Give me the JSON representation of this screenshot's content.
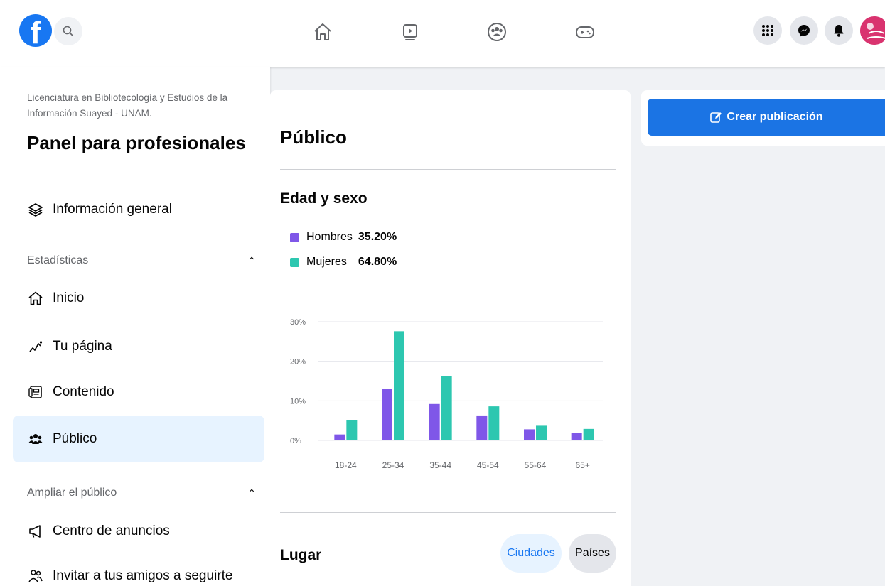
{
  "topbar": {
    "logo_letter": "f",
    "nav_icons": [
      "home-icon",
      "video-icon",
      "groups-icon",
      "gaming-icon"
    ],
    "right_icons": [
      "menu-grid-icon",
      "messenger-icon",
      "bell-icon"
    ]
  },
  "sidebar": {
    "page_name": "Licenciatura en Bibliotecología y Estudios de la Información Suayed - UNAM.",
    "title": "Panel para profesionales",
    "overview": "Información general",
    "stats_section": "Estadísticas",
    "items": [
      {
        "label": "Inicio",
        "icon": "home-outline-icon"
      },
      {
        "label": "Tu página",
        "icon": "trend-icon"
      },
      {
        "label": "Contenido",
        "icon": "content-icon"
      },
      {
        "label": "Público",
        "icon": "audience-icon"
      }
    ],
    "grow_section": "Ampliar el público",
    "ads_center": "Centro de anuncios",
    "invite": "Invitar a tus amigos a seguirte"
  },
  "main": {
    "title": "Público",
    "age_sex_title": "Edad y sexo",
    "legend": [
      {
        "label": "Hombres",
        "value": "35.20%",
        "color": "#7f57e8"
      },
      {
        "label": "Mujeres",
        "value": "64.80%",
        "color": "#2dc7b0"
      }
    ],
    "location_title": "Lugar",
    "location_tabs": [
      "Ciudades",
      "Países"
    ]
  },
  "right": {
    "create_post": "Crear publicación"
  },
  "chart_data": {
    "type": "bar",
    "categories": [
      "18-24",
      "25-34",
      "35-44",
      "45-54",
      "55-64",
      "65+"
    ],
    "series": [
      {
        "name": "Hombres",
        "values": [
          1.5,
          13,
          9.2,
          6.3,
          2.8,
          1.9
        ],
        "color": "#7f57e8"
      },
      {
        "name": "Mujeres",
        "values": [
          5.2,
          27.6,
          16.2,
          8.6,
          3.7,
          2.9
        ],
        "color": "#2dc7b0"
      }
    ],
    "ytick_labels": [
      "0%",
      "10%",
      "20%",
      "30%"
    ],
    "ylim": [
      0,
      30
    ],
    "grid": true
  }
}
